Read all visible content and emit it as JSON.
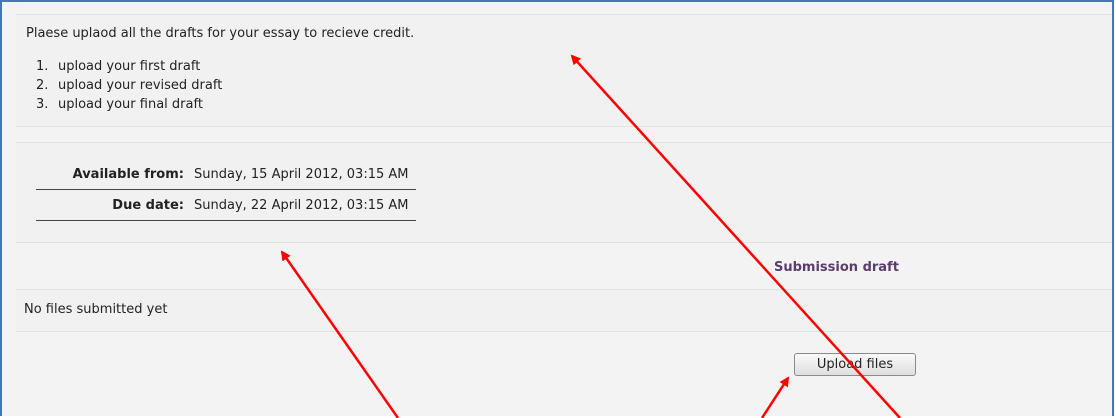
{
  "assignment": {
    "intro_text": "Plaese uplaod all the drafts for your essay to recieve credit.",
    "steps": [
      {
        "num": "1.",
        "text": "upload your first draft"
      },
      {
        "num": "2.",
        "text": "upload your revised draft"
      },
      {
        "num": "3.",
        "text": "upload your final draft"
      }
    ]
  },
  "dates": {
    "available_label": "Available from:",
    "available_value": "Sunday, 15 April 2012, 03:15 AM",
    "due_label": "Due date:",
    "due_value": "Sunday, 22 April 2012, 03:15 AM"
  },
  "submission": {
    "heading": "Submission draft",
    "status": "No files submitted yet",
    "upload_label": "Upload files"
  },
  "colors": {
    "frame_border": "#4a74b8",
    "heading": "#5a3d6c",
    "annotation_arrow": "#ff0000"
  }
}
